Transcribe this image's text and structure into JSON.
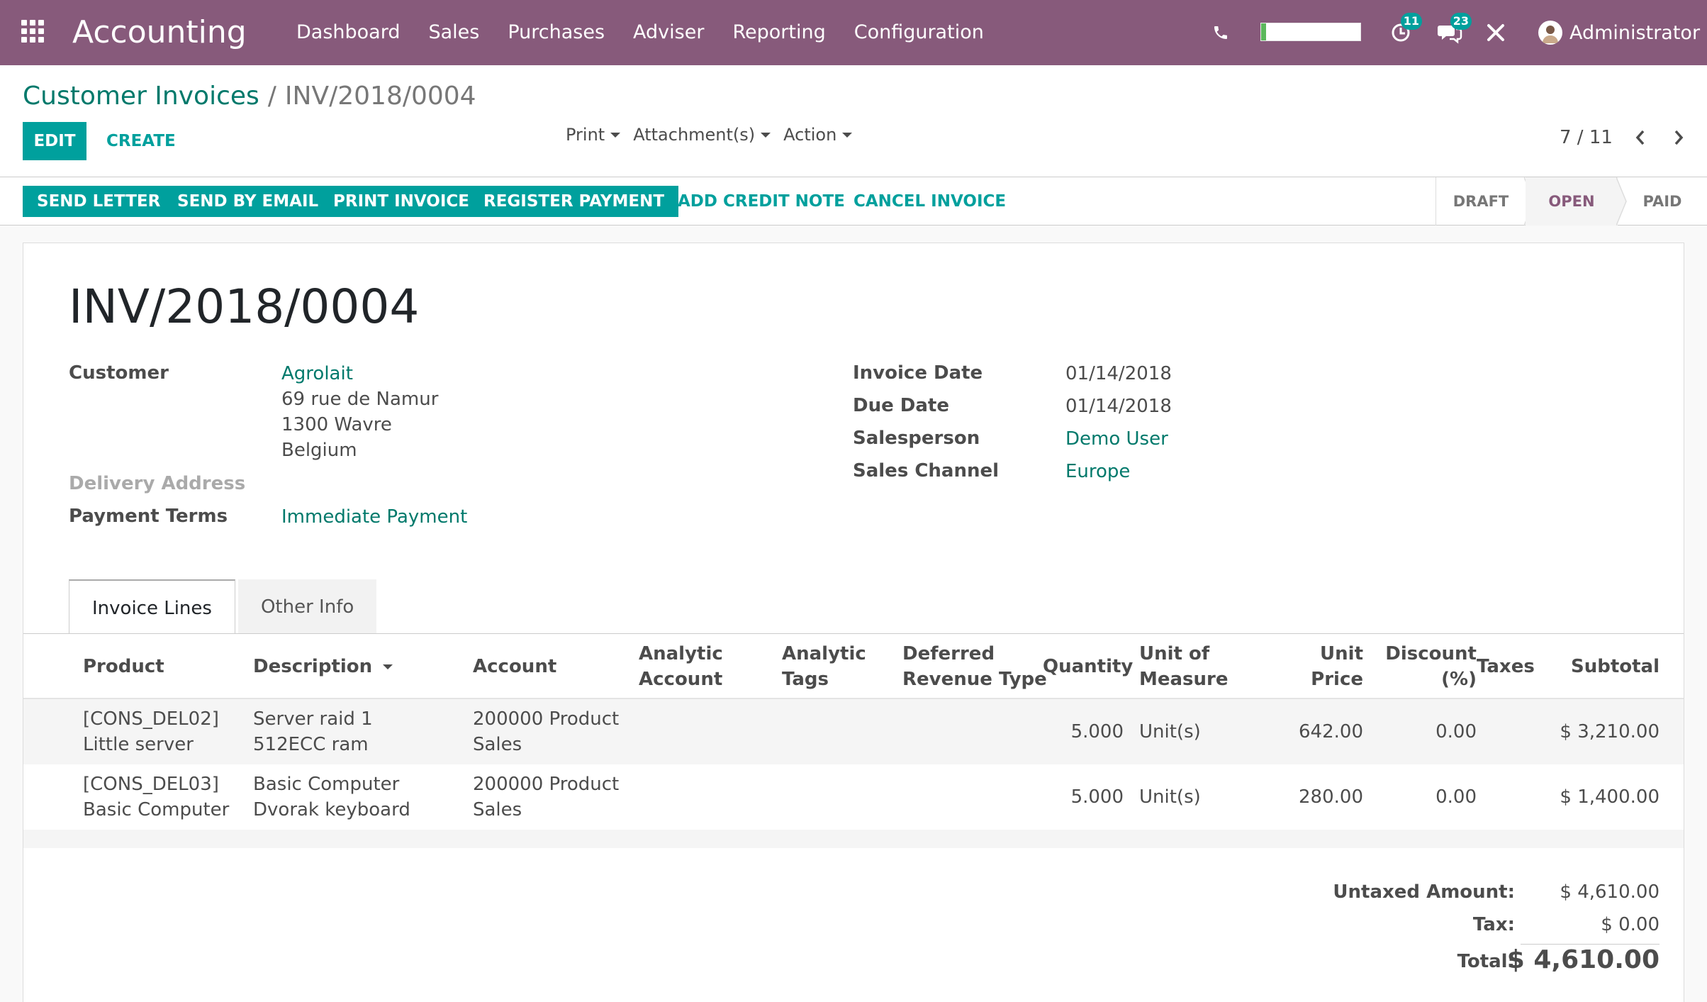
{
  "navbar": {
    "app_name": "Accounting",
    "menu": [
      "Dashboard",
      "Sales",
      "Purchases",
      "Adviser",
      "Reporting",
      "Configuration"
    ],
    "activity_count": "11",
    "messages_count": "23",
    "user_name": "Administrator",
    "progress_fraction": 0.05
  },
  "breadcrumb": {
    "parent": "Customer Invoices",
    "separator": "/",
    "current": "INV/2018/0004"
  },
  "actions": {
    "edit": "EDIT",
    "create": "CREATE",
    "print": "Print",
    "attachments": "Attachment(s)",
    "action": "Action"
  },
  "pager": {
    "value": "7 / 11"
  },
  "header_buttons": {
    "send_letter": "SEND LETTER",
    "send_by_email": "SEND BY EMAIL",
    "print_invoice": "PRINT INVOICE",
    "register_payment": "REGISTER PAYMENT",
    "add_credit_note": "ADD CREDIT NOTE",
    "cancel_invoice": "CANCEL INVOICE"
  },
  "statusbar": {
    "stages": [
      "DRAFT",
      "OPEN",
      "PAID"
    ],
    "active": "OPEN"
  },
  "invoice": {
    "number": "INV/2018/0004",
    "labels": {
      "customer": "Customer",
      "delivery_address": "Delivery Address",
      "payment_terms": "Payment Terms",
      "invoice_date": "Invoice Date",
      "due_date": "Due Date",
      "salesperson": "Salesperson",
      "sales_channel": "Sales Channel"
    },
    "customer_name": "Agrolait",
    "customer_address": [
      "69 rue de Namur",
      "1300 Wavre",
      "Belgium"
    ],
    "payment_terms": "Immediate Payment",
    "invoice_date": "01/14/2018",
    "due_date": "01/14/2018",
    "salesperson": "Demo User",
    "sales_channel": "Europe"
  },
  "tabs": [
    "Invoice Lines",
    "Other Info"
  ],
  "table": {
    "headers": {
      "product": "Product",
      "description": "Description",
      "account": "Account",
      "analytic_account": [
        "Analytic",
        "Account"
      ],
      "analytic_tags": [
        "Analytic",
        "Tags"
      ],
      "deferred": [
        "Deferred",
        "Revenue Type"
      ],
      "quantity": "Quantity",
      "uom": [
        "Unit of",
        "Measure"
      ],
      "unit_price": [
        "Unit",
        "Price"
      ],
      "discount": [
        "Discount",
        "(%)"
      ],
      "taxes": "Taxes",
      "subtotal": "Subtotal"
    },
    "rows": [
      {
        "product": [
          "[CONS_DEL02]",
          "Little server"
        ],
        "description": [
          "Server raid 1",
          "512ECC ram"
        ],
        "account": [
          "200000 Product",
          "Sales"
        ],
        "quantity": "5.000",
        "uom": "Unit(s)",
        "unit_price": "642.00",
        "discount": "0.00",
        "subtotal": "$ 3,210.00"
      },
      {
        "product": [
          "[CONS_DEL03]",
          "Basic Computer"
        ],
        "description": [
          "Basic Computer",
          "Dvorak keyboard"
        ],
        "account": [
          "200000 Product",
          "Sales"
        ],
        "quantity": "5.000",
        "uom": "Unit(s)",
        "unit_price": "280.00",
        "discount": "0.00",
        "subtotal": "$ 1,400.00"
      }
    ]
  },
  "totals": {
    "untaxed_label": "Untaxed Amount:",
    "untaxed_value": "$ 4,610.00",
    "tax_label": "Tax:",
    "tax_value": "$ 0.00",
    "total_label": "Total:",
    "total_value": "$ 4,610.00"
  },
  "colors": {
    "navbar": "#875a7b",
    "primary": "#00a09d",
    "link": "#00796b"
  }
}
